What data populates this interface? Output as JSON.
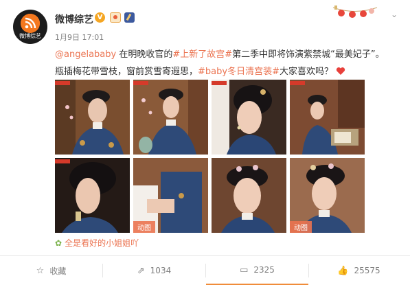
{
  "post": {
    "author": "微博综艺",
    "avatar_caption": "微博综艺",
    "verified_mark": "V",
    "time": "1月9日 17:01",
    "text": {
      "mention": "@angelababy",
      "part1": " 在明晚收官的",
      "tag1": "#上新了故宫#",
      "part2": "第二季中即将饰演紫禁城“最美妃子”。",
      "part3": "瓶插梅花带雪枝，窗前赏雪寄遐思，",
      "tag2": "#baby冬日清宫装#",
      "part4": "大家喜欢吗？"
    },
    "photos": [
      {
        "gif": ""
      },
      {
        "gif": ""
      },
      {
        "gif": ""
      },
      {
        "gif": ""
      },
      {
        "gif": ""
      },
      {
        "gif": "动图"
      },
      {
        "gif": ""
      },
      {
        "gif": "动图"
      }
    ],
    "source_text": "全是看好的小姐姐吖"
  },
  "actions": {
    "favorite": {
      "label": "收藏",
      "icon": "star-icon"
    },
    "repost": {
      "count": "1034",
      "icon": "repost-icon"
    },
    "comment": {
      "count": "2325",
      "icon": "comment-icon"
    },
    "like": {
      "count": "25575",
      "icon": "thumbs-up-icon"
    }
  },
  "colors": {
    "accent": "#eb7350",
    "text": "#333333",
    "muted": "#808080",
    "active_underline": "#f08c3a"
  }
}
